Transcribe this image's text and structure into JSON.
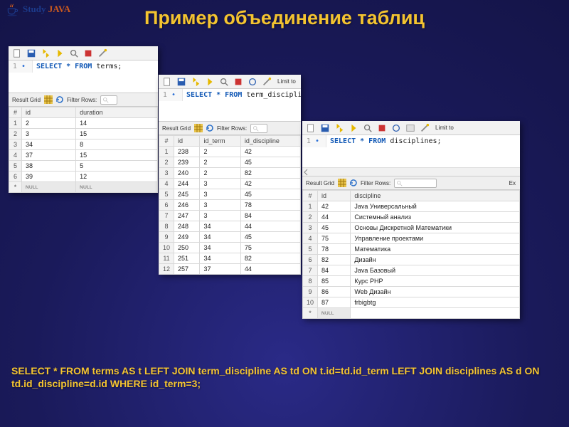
{
  "logo": {
    "study": "Study",
    "java": "JAVA"
  },
  "title": "Пример объединение таблиц",
  "footer_sql": "SELECT * FROM terms AS t LEFT JOIN term_discipline AS td ON t.id=td.id_term LEFT JOIN disciplines AS d ON td.id_discipline=d.id WHERE id_term=3;",
  "labels": {
    "result_grid": "Result Grid",
    "filter_rows": "Filter Rows:",
    "limit_to": "Limit to"
  },
  "panel1": {
    "sql_kw": "SELECT * FROM",
    "sql_ident": "terms;",
    "line": "1",
    "cols": [
      "#",
      "id",
      "duration"
    ],
    "rows": [
      [
        "1",
        "2",
        "14"
      ],
      [
        "2",
        "3",
        "15"
      ],
      [
        "3",
        "34",
        "8"
      ],
      [
        "4",
        "37",
        "15"
      ],
      [
        "5",
        "38",
        "5"
      ],
      [
        "6",
        "39",
        "12"
      ],
      [
        "*",
        "NULL",
        "NULL"
      ]
    ]
  },
  "panel2": {
    "sql_kw": "SELECT * FROM",
    "sql_ident": "term_discipline;",
    "line": "1",
    "cols": [
      "#",
      "id",
      "id_term",
      "id_discipline"
    ],
    "rows": [
      [
        "1",
        "238",
        "2",
        "42"
      ],
      [
        "2",
        "239",
        "2",
        "45"
      ],
      [
        "3",
        "240",
        "2",
        "82"
      ],
      [
        "4",
        "244",
        "3",
        "42"
      ],
      [
        "5",
        "245",
        "3",
        "45"
      ],
      [
        "6",
        "246",
        "3",
        "78"
      ],
      [
        "7",
        "247",
        "3",
        "84"
      ],
      [
        "8",
        "248",
        "34",
        "44"
      ],
      [
        "9",
        "249",
        "34",
        "45"
      ],
      [
        "10",
        "250",
        "34",
        "75"
      ],
      [
        "11",
        "251",
        "34",
        "82"
      ],
      [
        "12",
        "257",
        "37",
        "44"
      ]
    ]
  },
  "panel3": {
    "sql_kw": "SELECT * FROM",
    "sql_ident": "disciplines;",
    "line": "1",
    "export_label": "Ex",
    "cols": [
      "#",
      "id",
      "discipline"
    ],
    "rows": [
      [
        "1",
        "42",
        "Java Универсальный"
      ],
      [
        "2",
        "44",
        "Системный анализ"
      ],
      [
        "3",
        "45",
        "Основы Дискретной Математики"
      ],
      [
        "4",
        "75",
        "Управление проектами"
      ],
      [
        "5",
        "78",
        "Математика"
      ],
      [
        "6",
        "82",
        "Дизайн"
      ],
      [
        "7",
        "84",
        "Java Базовый"
      ],
      [
        "8",
        "85",
        "Курс PHP"
      ],
      [
        "9",
        "86",
        "Web Дизайн"
      ],
      [
        "10",
        "87",
        "frbigbtg"
      ],
      [
        "*",
        "NULL",
        ""
      ]
    ]
  }
}
